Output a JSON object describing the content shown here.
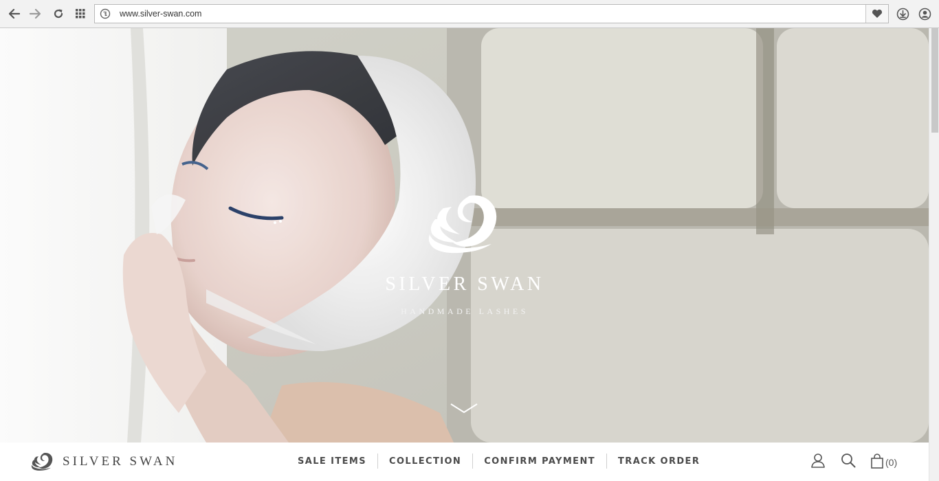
{
  "browser": {
    "url": "www.silver-swan.com",
    "icons": [
      "back-icon",
      "forward-icon",
      "reload-icon",
      "apps-grid-icon",
      "site-info-icon",
      "heart-icon",
      "download-icon",
      "account-icon"
    ]
  },
  "hero": {
    "title": "SILVER SWAN",
    "subtitle": "HANDMADE LASHES",
    "logo_icon": "swan-logo-icon",
    "scroll_icon": "chevron-down-icon"
  },
  "site_nav": {
    "logo_text": "SILVER SWAN",
    "menu": [
      {
        "label": "SALE ITEMS"
      },
      {
        "label": "COLLECTION"
      },
      {
        "label": "CONFIRM PAYMENT"
      },
      {
        "label": "TRACK ORDER"
      }
    ],
    "cart_count": "(0)",
    "icons": [
      "user-icon",
      "search-icon",
      "shopping-bag-icon"
    ]
  },
  "colors": {
    "nav_text": "#4a4a4a",
    "hero_text": "#ffffff",
    "browser_chrome": "#f2f2f2"
  }
}
